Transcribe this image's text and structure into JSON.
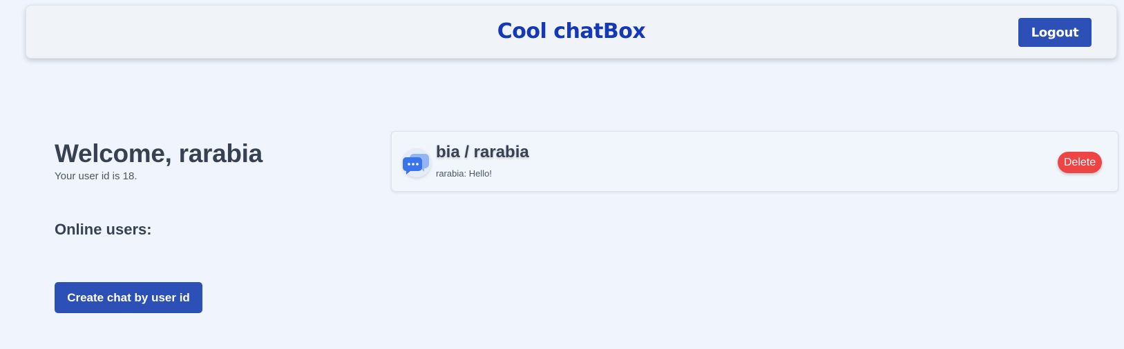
{
  "header": {
    "title": "Cool chatBox",
    "logout_label": "Logout"
  },
  "welcome": {
    "heading": "Welcome, rarabia",
    "user_id_text": "Your user id is 18."
  },
  "online_users": {
    "heading": "Online users:",
    "users": []
  },
  "actions": {
    "create_chat_label": "Create chat by user id"
  },
  "chats": [
    {
      "title": "bia / rarabia",
      "last_message": "rarabia: Hello!",
      "delete_label": "Delete",
      "icon": "chat-bubbles-icon"
    }
  ],
  "colors": {
    "primary": "#2c50b5",
    "title": "#1538b8",
    "danger": "#ef4444",
    "background": "#f0f5fd"
  }
}
